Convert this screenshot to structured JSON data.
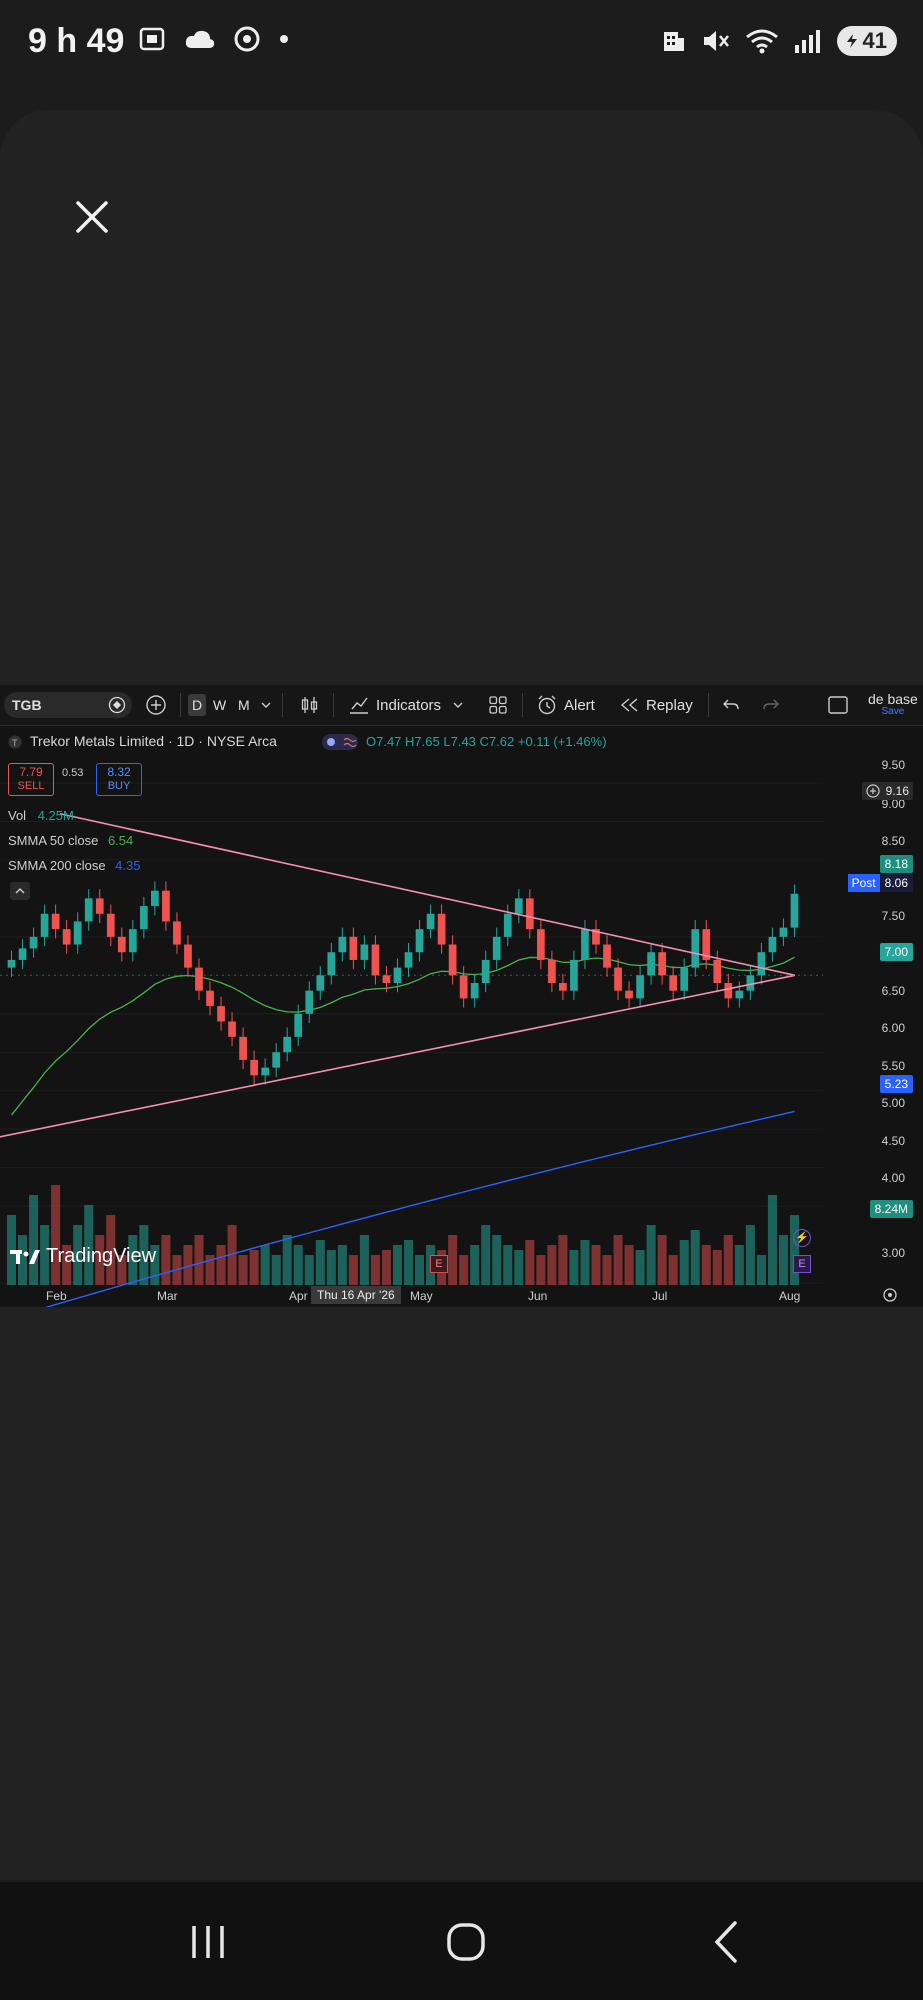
{
  "status_bar": {
    "time": "9 h 49",
    "battery": "41",
    "icons_left": [
      "screenshot-icon",
      "cloud-icon",
      "chrome-icon",
      "dot-icon"
    ],
    "icons_right": [
      "hotel-icon",
      "mute-icon",
      "wifi-icon",
      "signal-icon",
      "battery-icon"
    ]
  },
  "toolbar": {
    "symbol": "TGB",
    "intervals": [
      "D",
      "W",
      "M"
    ],
    "indicators_label": "Indicators",
    "alert_label": "Alert",
    "replay_label": "Replay",
    "layout_label": "de base",
    "save_label": "Save"
  },
  "legend": {
    "title": "Trekor Metals Limited · 1D · NYSE Arca",
    "ohlc_o": "O7.47",
    "ohlc_h": "H7.65",
    "ohlc_l": "L7.43",
    "ohlc_c": "C7.62",
    "change": "+0.11 (+1.46%)",
    "sell_price": "7.79",
    "sell_label": "SELL",
    "spread": "0.53",
    "buy_price": "8.32",
    "buy_label": "BUY",
    "vol_label": "Vol",
    "vol_value": "4.25M",
    "smma50_label": "SMMA 50 close",
    "smma50_value": "6.54",
    "smma200_label": "SMMA 200 close",
    "smma200_value": "4.35"
  },
  "colors": {
    "up": "#26a69a",
    "down": "#ef5350",
    "smma50": "#4caf50",
    "smma200": "#2962ff",
    "trendline": "#f48fb1",
    "background": "#131313"
  },
  "chart_data": {
    "type": "candlestick",
    "y_ticks": [
      "9.50",
      "9.00",
      "8.50",
      "7.50",
      "6.50",
      "6.00",
      "5.50",
      "5.00",
      "4.50",
      "4.00",
      "3.00"
    ],
    "x_ticks": [
      "Feb",
      "Mar",
      "Apr",
      "May",
      "Jun",
      "Jul",
      "Aug"
    ],
    "crosshair_x": "Thu 16 Apr '26",
    "ylim": [
      3.0,
      9.5
    ],
    "price_tags": {
      "crosshair": "9.16",
      "high_mark": "8.18",
      "post_label": "Post",
      "post_value": "8.06",
      "last": "7.00",
      "smma200": "5.23",
      "volume": "8.24M"
    },
    "closes": [
      7.2,
      7.35,
      7.5,
      7.8,
      7.6,
      7.4,
      7.7,
      8.0,
      7.8,
      7.5,
      7.3,
      7.6,
      7.9,
      8.1,
      7.7,
      7.4,
      7.1,
      6.8,
      6.6,
      6.4,
      6.2,
      5.9,
      5.7,
      5.8,
      6.0,
      6.2,
      6.5,
      6.8,
      7.0,
      7.3,
      7.5,
      7.2,
      7.4,
      7.0,
      6.9,
      7.1,
      7.3,
      7.6,
      7.8,
      7.4,
      7.0,
      6.7,
      6.9,
      7.2,
      7.5,
      7.8,
      8.0,
      7.6,
      7.2,
      6.9,
      6.8,
      7.2,
      7.6,
      7.4,
      7.1,
      6.8,
      6.7,
      7.0,
      7.3,
      7.0,
      6.8,
      7.1,
      7.6,
      7.2,
      6.9,
      6.7,
      6.8,
      7.0,
      7.3,
      7.5,
      7.62,
      8.06
    ],
    "volumes": [
      0.7,
      0.5,
      0.9,
      0.6,
      1.0,
      0.4,
      0.6,
      0.8,
      0.5,
      0.7,
      0.3,
      0.5,
      0.6,
      0.4,
      0.5,
      0.3,
      0.4,
      0.5,
      0.3,
      0.4,
      0.6,
      0.3,
      0.35,
      0.4,
      0.3,
      0.5,
      0.4,
      0.3,
      0.45,
      0.35,
      0.4,
      0.3,
      0.5,
      0.3,
      0.35,
      0.4,
      0.45,
      0.3,
      0.4,
      0.35,
      0.5,
      0.3,
      0.4,
      0.6,
      0.5,
      0.4,
      0.35,
      0.45,
      0.3,
      0.4,
      0.5,
      0.35,
      0.45,
      0.4,
      0.3,
      0.5,
      0.4,
      0.35,
      0.6,
      0.5,
      0.3,
      0.45,
      0.55,
      0.4,
      0.35,
      0.5,
      0.4,
      0.6,
      0.3,
      0.9,
      0.5,
      0.7
    ]
  },
  "branding": {
    "logo_text": "TradingView"
  }
}
